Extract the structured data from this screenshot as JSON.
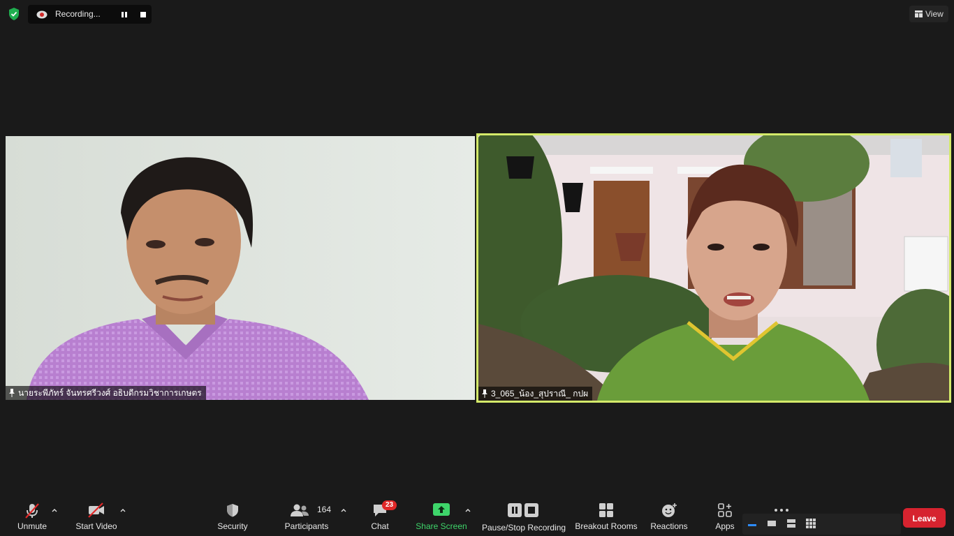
{
  "top": {
    "recording_label": "Recording...",
    "view_label": "View"
  },
  "participants_video": [
    {
      "name": "นายระพีภัทร์ จันทรศรีวงศ์ อธิบดีกรมวิชาการเกษตร",
      "active_speaker": false
    },
    {
      "name": "3_065_น้อง_สุปราณี_ กปผ",
      "active_speaker": true
    }
  ],
  "toolbar": {
    "unmute": "Unmute",
    "start_video": "Start Video",
    "security": "Security",
    "participants": "Participants",
    "participants_count": "164",
    "chat": "Chat",
    "chat_badge": "23",
    "share_screen": "Share Screen",
    "pause_stop_recording": "Pause/Stop Recording",
    "breakout_rooms": "Breakout Rooms",
    "reactions": "Reactions",
    "apps": "Apps",
    "leave": "Leave"
  },
  "colors": {
    "background": "#1a1a1a",
    "active_speaker_border": "#d4ea6a",
    "share_green": "#3ed56a",
    "leave_red": "#d6232f",
    "badge_red": "#e02828"
  },
  "icons": [
    "shield-check-icon",
    "recording-cloud-icon",
    "pause-icon",
    "stop-icon",
    "view-grid-icon",
    "pin-icon",
    "mic-muted-icon",
    "video-off-icon",
    "shield-icon",
    "participants-icon",
    "chat-icon",
    "share-screen-icon",
    "pause-stop-icon",
    "breakout-rooms-icon",
    "reactions-icon",
    "apps-icon",
    "more-icon"
  ]
}
